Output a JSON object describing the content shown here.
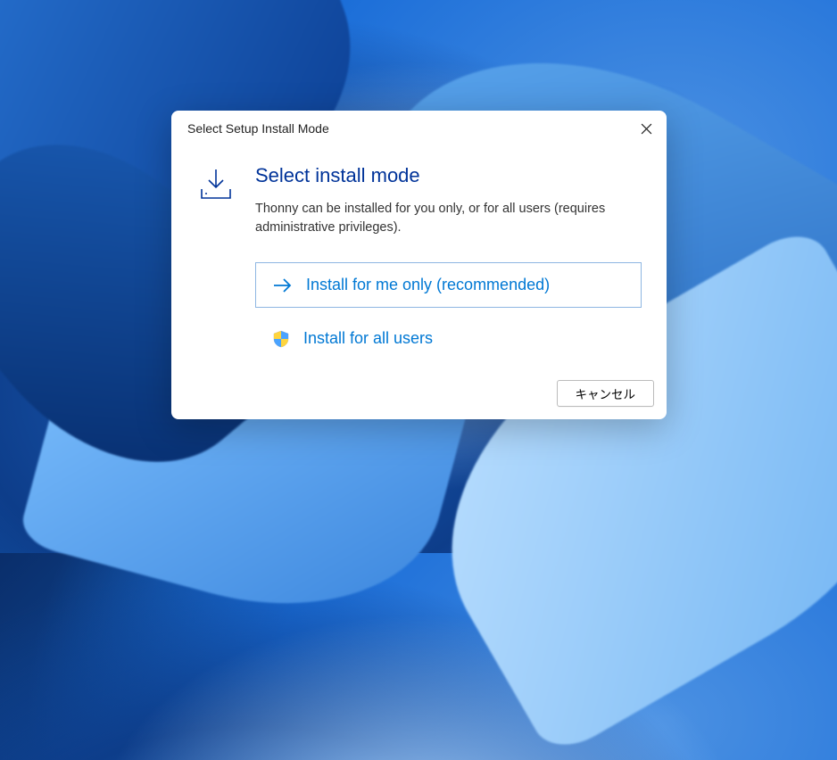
{
  "dialog": {
    "title": "Select Setup Install Mode",
    "heading": "Select install mode",
    "description": "Thonny can be installed for you only, or for all users (requires administrative privileges).",
    "options": {
      "me_only": "Install for me only (recommended)",
      "all_users": "Install for all users"
    },
    "cancel": "キャンセル"
  }
}
